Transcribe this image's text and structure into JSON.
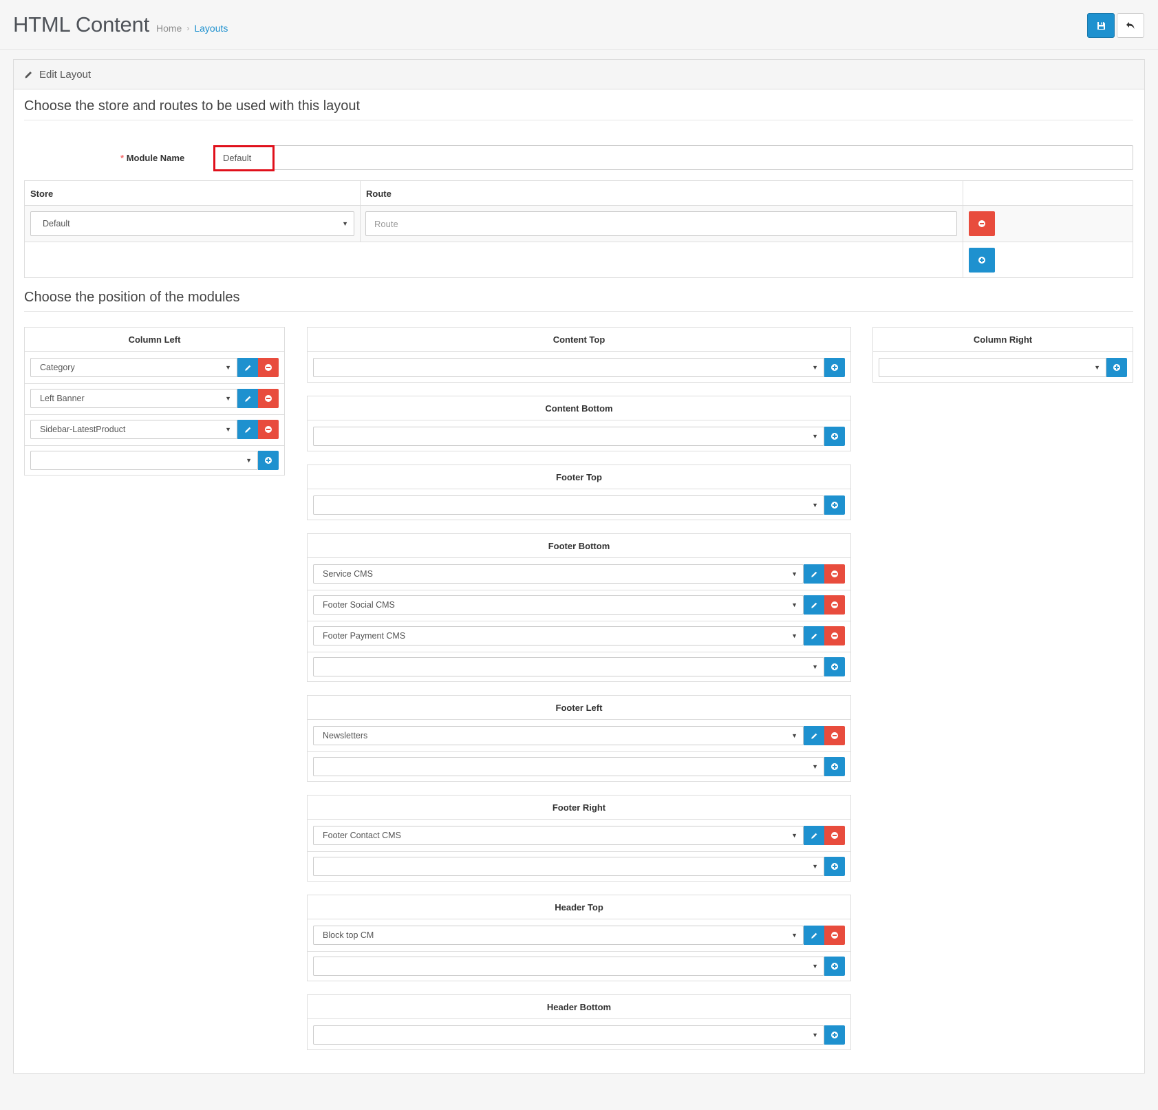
{
  "header": {
    "title": "HTML Content",
    "breadcrumb": {
      "home": "Home",
      "separator": "›",
      "current": "Layouts"
    }
  },
  "toolbar": {
    "save_icon": "save-icon",
    "back_icon": "reply-icon"
  },
  "panel": {
    "heading_icon": "pencil-icon",
    "heading": "Edit Layout",
    "section_routes": "Choose the store and routes to be used with this layout",
    "section_modules": "Choose the position of the modules"
  },
  "form": {
    "module_name_required": "*",
    "module_name_label": "Module Name",
    "module_name_value": "Default"
  },
  "routes_table": {
    "headers": {
      "store": "Store",
      "route": "Route"
    },
    "row": {
      "store_value": "Default",
      "route_placeholder": "Route"
    }
  },
  "positions": {
    "column_left": {
      "title": "Column Left",
      "modules": [
        "Category",
        "Left Banner",
        "Sidebar-LatestProduct"
      ]
    },
    "content_top": {
      "title": "Content Top",
      "modules": []
    },
    "column_right": {
      "title": "Column Right",
      "modules": []
    },
    "content_bottom": {
      "title": "Content Bottom",
      "modules": []
    },
    "footer_top": {
      "title": "Footer Top",
      "modules": []
    },
    "footer_bottom": {
      "title": "Footer Bottom",
      "modules": [
        "Service CMS",
        "Footer Social CMS",
        "Footer Payment CMS"
      ]
    },
    "footer_left": {
      "title": "Footer Left",
      "modules": [
        "Newsletters"
      ]
    },
    "footer_right": {
      "title": "Footer Right",
      "modules": [
        "Footer Contact CMS"
      ]
    },
    "header_top": {
      "title": "Header Top",
      "modules": [
        "Block top CM"
      ]
    },
    "header_bottom": {
      "title": "Header Bottom",
      "modules": []
    }
  },
  "colors": {
    "primary": "#1e91cf",
    "danger": "#e84c3d",
    "highlight": "#e0101b"
  }
}
